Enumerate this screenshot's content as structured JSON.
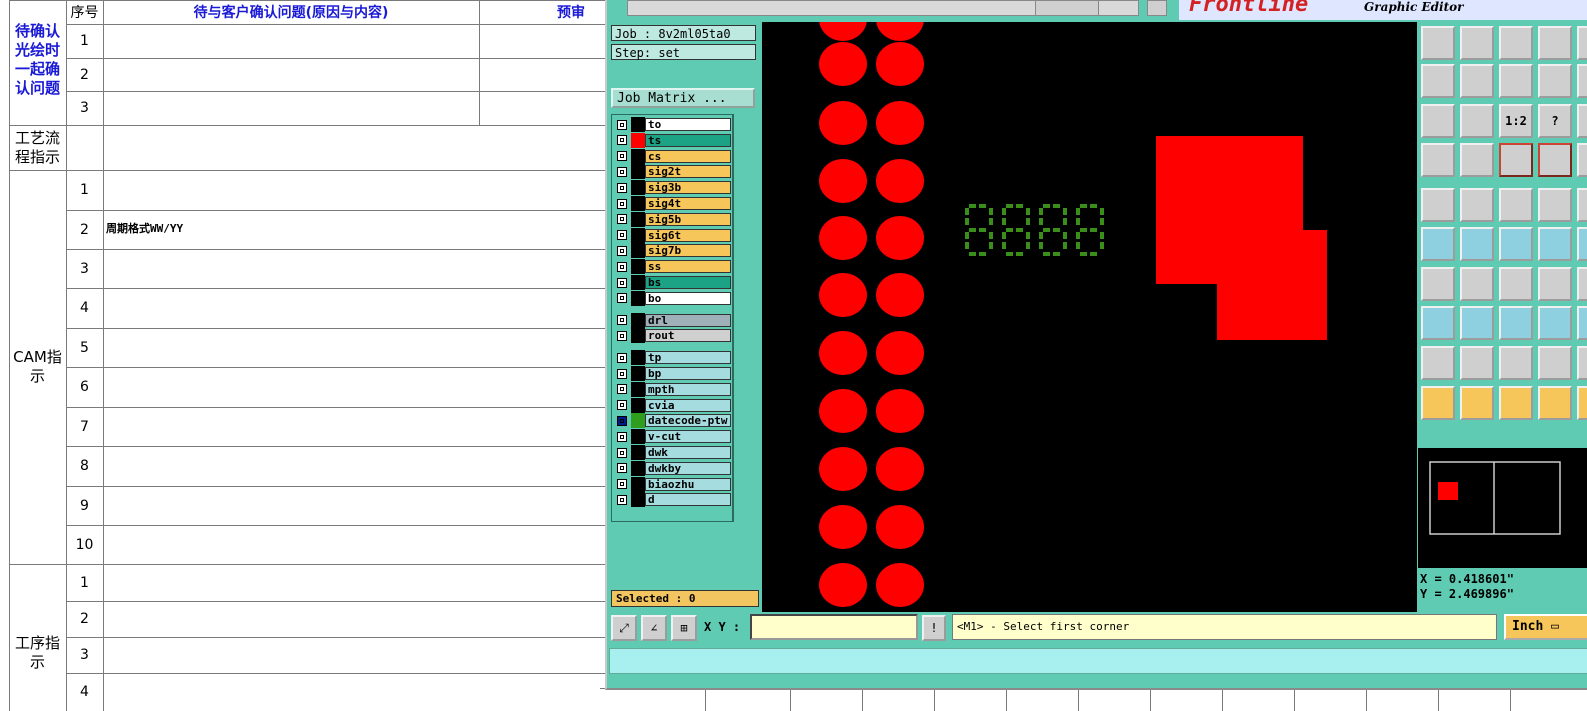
{
  "spreadsheet": {
    "headers": {
      "seq": "序号",
      "issues": "待与客户确认问题(原因与内容)",
      "review": "预审"
    },
    "section_confirm": "待确认光绘时一起确认问题",
    "section_process": "工艺流程指示",
    "section_cam": "CAM指示",
    "section_step": "工序指示",
    "confirm_rows": [
      "1",
      "2",
      "3"
    ],
    "cam_rows": [
      "1",
      "2",
      "3",
      "4",
      "5",
      "6",
      "7",
      "8",
      "9",
      "10"
    ],
    "step_rows": [
      "1",
      "2",
      "3",
      "4"
    ],
    "cam_row2_note": "周期格式WW/YY"
  },
  "cad": {
    "brand": "Frontline",
    "brand_sub": "Graphic Editor",
    "job": "Job : 8v2ml05ta0",
    "step": "Step: set",
    "job_matrix": "Job Matrix ...",
    "layers_board": [
      {
        "name": "to",
        "color": "#ffffff",
        "swatch": "#000000"
      },
      {
        "name": "ts",
        "color": "#1ca386",
        "swatch": "#ff0000"
      },
      {
        "name": "cs",
        "color": "#f6c65a",
        "swatch": "#000000"
      },
      {
        "name": "sig2t",
        "color": "#f6c65a",
        "swatch": "#000000"
      },
      {
        "name": "sig3b",
        "color": "#f6c65a",
        "swatch": "#000000"
      },
      {
        "name": "sig4t",
        "color": "#f6c65a",
        "swatch": "#000000"
      },
      {
        "name": "sig5b",
        "color": "#f6c65a",
        "swatch": "#000000"
      },
      {
        "name": "sig6t",
        "color": "#f6c65a",
        "swatch": "#000000"
      },
      {
        "name": "sig7b",
        "color": "#f6c65a",
        "swatch": "#000000"
      },
      {
        "name": "ss",
        "color": "#f6c65a",
        "swatch": "#000000"
      },
      {
        "name": "bs",
        "color": "#1ca386",
        "swatch": "#000000"
      },
      {
        "name": "bo",
        "color": "#ffffff",
        "swatch": "#000000"
      }
    ],
    "layers_drill": [
      {
        "name": "drl",
        "color": "#9fb0b8",
        "swatch": "#000000"
      },
      {
        "name": "rout",
        "color": "#d0d0d0",
        "swatch": "#000000"
      }
    ],
    "layers_misc": [
      {
        "name": "tp",
        "color": "#a5dce0",
        "swatch": "#000000"
      },
      {
        "name": "bp",
        "color": "#a5dce0",
        "swatch": "#000000"
      },
      {
        "name": "mpth",
        "color": "#a5dce0",
        "swatch": "#000000"
      },
      {
        "name": "cvia",
        "color": "#a5dce0",
        "swatch": "#000000"
      },
      {
        "name": "datecode-ptw",
        "color": "#a5dce0",
        "swatch": "#2f9e1f"
      },
      {
        "name": "v-cut",
        "color": "#a5dce0",
        "swatch": "#000000"
      },
      {
        "name": "dwk",
        "color": "#a5dce0",
        "swatch": "#000000"
      },
      {
        "name": "dwkby",
        "color": "#a5dce0",
        "swatch": "#000000"
      },
      {
        "name": "biaozhu",
        "color": "#a5dce0",
        "swatch": "#000000"
      },
      {
        "name": "d",
        "color": "#a5dce0",
        "swatch": "#000000"
      }
    ],
    "selected": "Selected : 0",
    "coord_x": "X = 0.418601\"",
    "coord_y": "Y = 2.469896\"",
    "xy_label": "X Y :",
    "xy_value": "",
    "message": "<M1> - Select first corner",
    "unit": "Inch",
    "icons": {
      "ratio": "1:2",
      "help": "?"
    }
  }
}
